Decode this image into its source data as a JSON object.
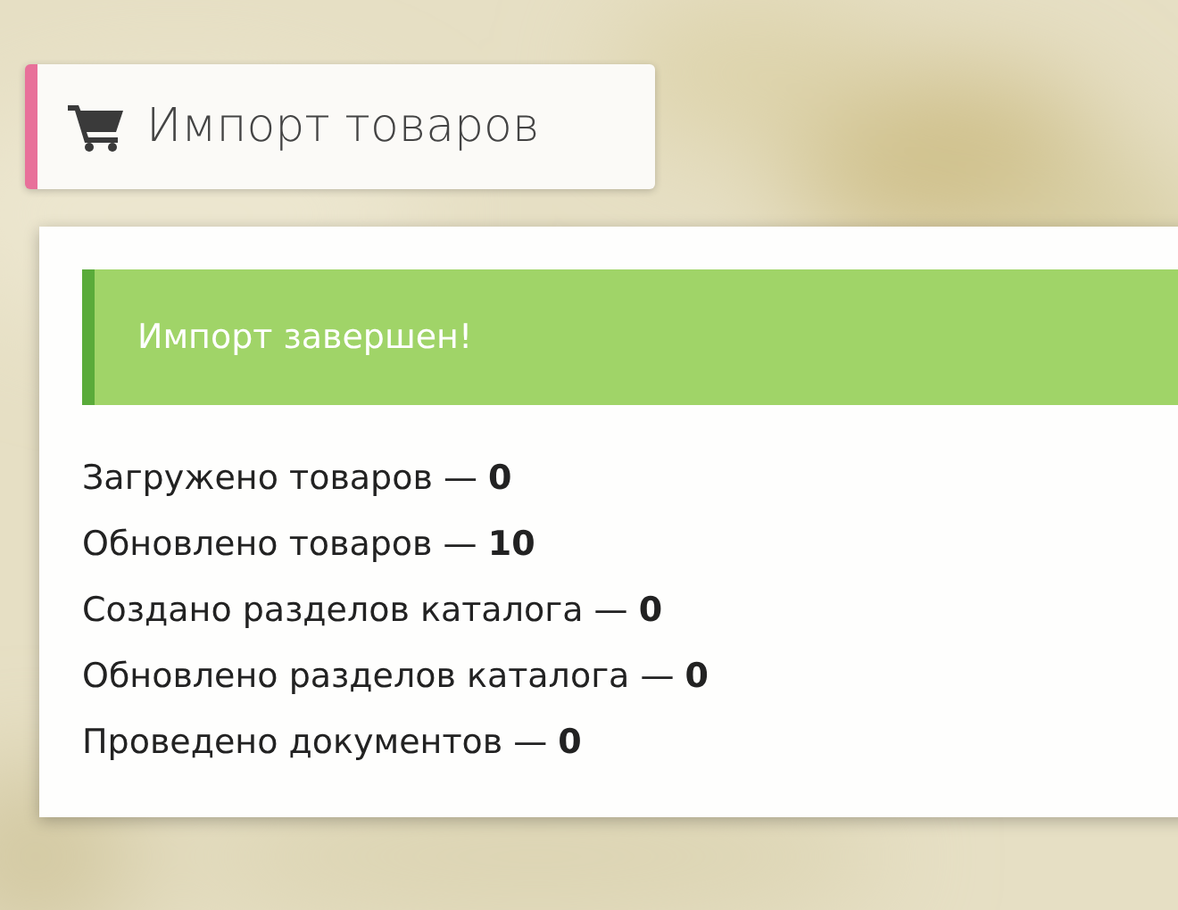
{
  "header": {
    "title": "Импорт товаров"
  },
  "alert": {
    "text": "Импорт завершен!"
  },
  "results": [
    "Загружено товаров — **0**",
    "Обновлено товаров — **10**",
    "Создано разделов каталога — **0**",
    "Обновлено разделов каталога — **0**",
    "Проведено документов — **0**"
  ]
}
